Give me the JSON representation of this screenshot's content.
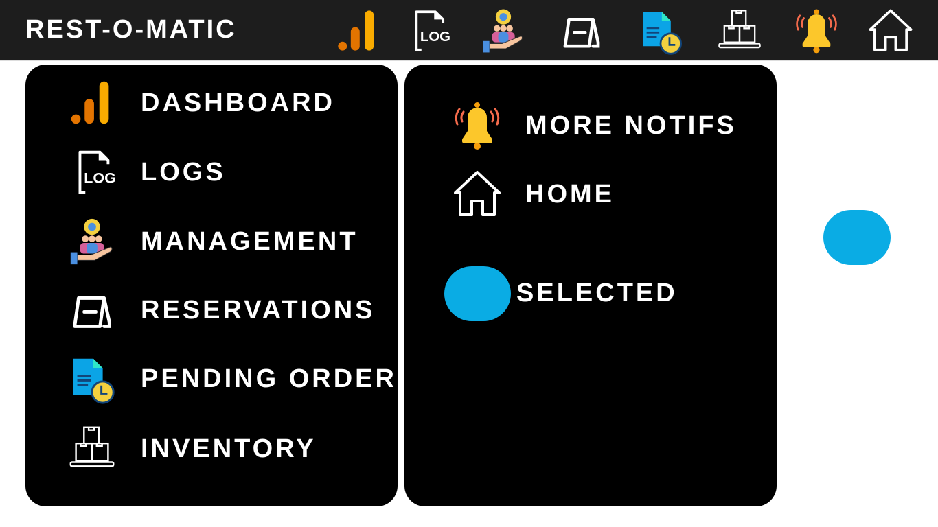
{
  "header": {
    "title": "REST-O-MATIC",
    "icons": [
      "dashboard-icon",
      "log-icon",
      "management-icon",
      "reservations-icon",
      "pending-orders-icon",
      "inventory-icon",
      "notification-bell-icon",
      "home-icon"
    ]
  },
  "menu": {
    "items": [
      {
        "label": "DASHBOARD",
        "icon": "dashboard"
      },
      {
        "label": "LOGS",
        "icon": "log"
      },
      {
        "label": "MANAGEMENT",
        "icon": "management"
      },
      {
        "label": "RESERVATIONS",
        "icon": "reservations"
      },
      {
        "label": "PENDING ORDERS",
        "icon": "pending"
      },
      {
        "label": "INVENTORY",
        "icon": "inventory"
      }
    ]
  },
  "legend": {
    "more_notifs": "MORE NOTIFS",
    "home": "HOME",
    "selected": "SELECTED"
  },
  "colors": {
    "accent": "#0aace4",
    "panel": "#000000",
    "header": "#1d1d1d"
  }
}
